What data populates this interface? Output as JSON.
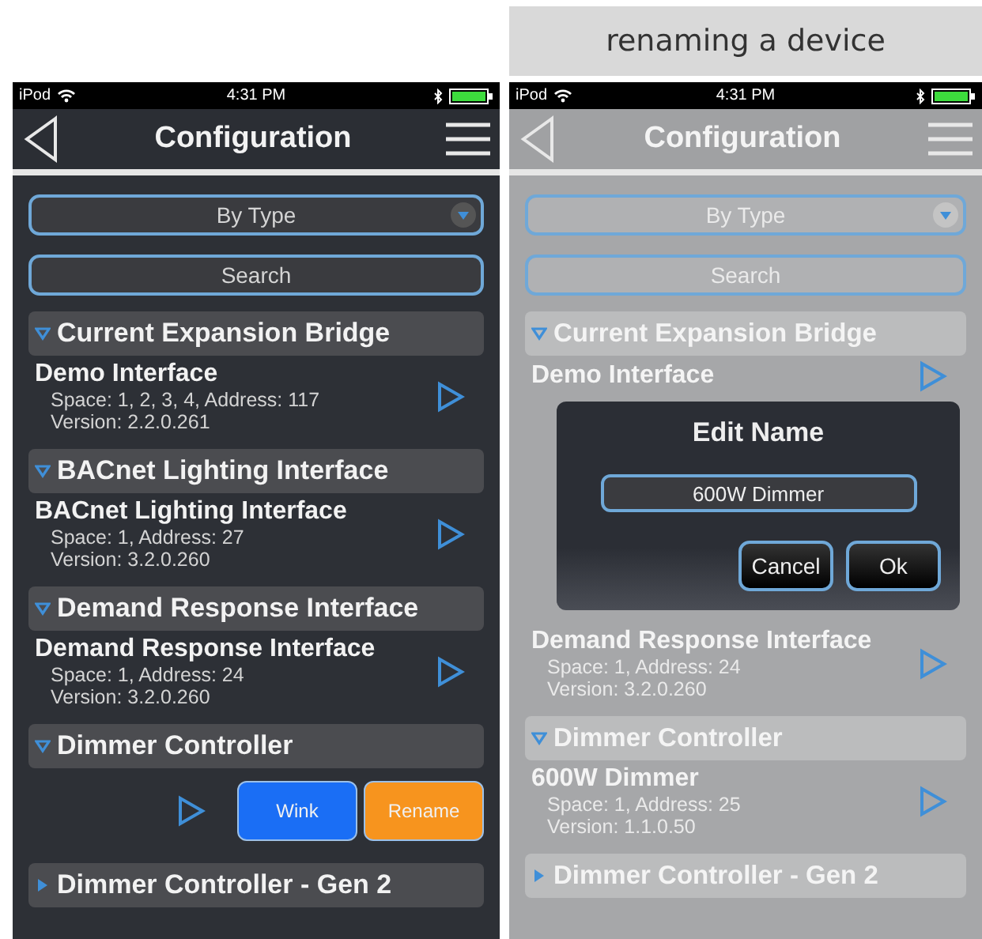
{
  "caption": "renaming a device",
  "screens": [
    {
      "dimmed": false,
      "status": {
        "carrier": "iPod",
        "time": "4:31 PM"
      },
      "title": "Configuration",
      "filter": {
        "value": "By Type"
      },
      "search": {
        "placeholder": "Search"
      },
      "rows": [
        {
          "kind": "header",
          "label": "Current Expansion Bridge",
          "expanded": true
        },
        {
          "kind": "device",
          "name": "Demo Interface",
          "details": [
            "Space: 1, 2, 3, 4, Address: 117",
            "Version: 2.2.0.261"
          ]
        },
        {
          "kind": "header",
          "label": "BACnet Lighting Interface",
          "expanded": true
        },
        {
          "kind": "device",
          "name": "BACnet Lighting Interface",
          "details": [
            "Space: 1, Address: 27",
            "Version: 3.2.0.260"
          ]
        },
        {
          "kind": "header",
          "label": "Demand Response Interface",
          "expanded": true
        },
        {
          "kind": "device",
          "name": "Demand Response Interface",
          "details": [
            "Space: 1, Address: 24",
            "Version: 3.2.0.260"
          ]
        },
        {
          "kind": "header",
          "label": "Dimmer Controller",
          "expanded": true
        },
        {
          "kind": "actions",
          "buttons": [
            {
              "label": "Wink",
              "color": "#1a6ef5"
            },
            {
              "label": "Rename",
              "color": "#f7941e"
            }
          ]
        },
        {
          "kind": "header",
          "label": "Dimmer Controller - Gen 2",
          "expanded": false
        }
      ]
    },
    {
      "dimmed": true,
      "status": {
        "carrier": "iPod",
        "time": "4:31 PM"
      },
      "title": "Configuration",
      "filter": {
        "value": "By Type"
      },
      "search": {
        "placeholder": "Search"
      },
      "rows": [
        {
          "kind": "header",
          "label": "Current Expansion Bridge",
          "expanded": true
        },
        {
          "kind": "device",
          "name": "Demo Interface",
          "details": []
        },
        {
          "kind": "dialog",
          "title": "Edit Name",
          "value": "600W Dimmer",
          "buttons": [
            "Cancel",
            "Ok"
          ]
        },
        {
          "kind": "device",
          "name": "Demand Response Interface",
          "details": [
            "Space: 1, Address: 24",
            "Version: 3.2.0.260"
          ]
        },
        {
          "kind": "header",
          "label": "Dimmer Controller",
          "expanded": true
        },
        {
          "kind": "device",
          "name": "600W Dimmer",
          "details": [
            "Space: 1, Address: 25",
            "Version: 1.1.0.50"
          ]
        },
        {
          "kind": "header",
          "label": "Dimmer Controller - Gen 2",
          "expanded": false
        }
      ]
    }
  ]
}
